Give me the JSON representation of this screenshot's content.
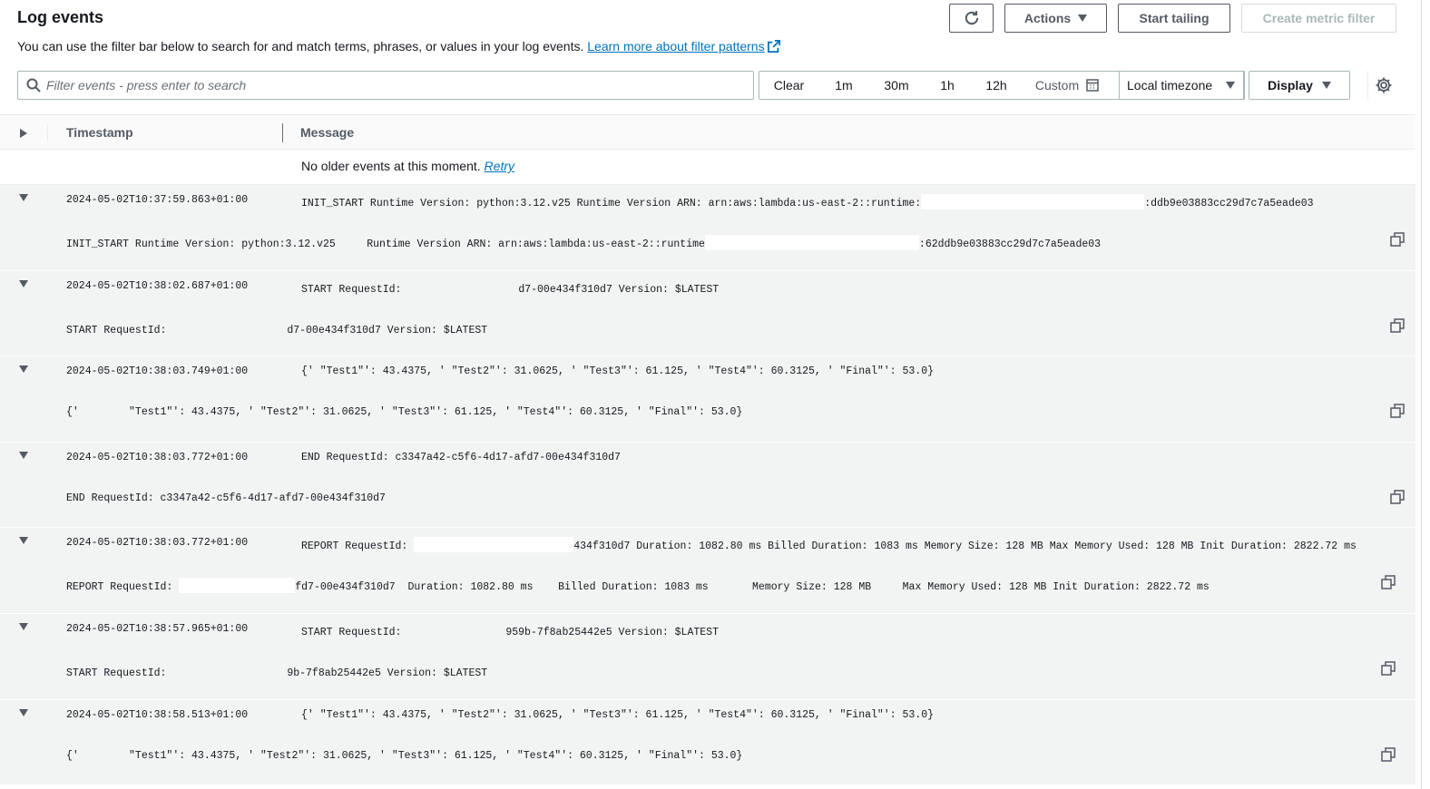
{
  "header": {
    "title": "Log events",
    "subtitle": "You can use the filter bar below to search for and match terms, phrases, or values in your log events.",
    "learn_more": "Learn more about filter patterns"
  },
  "toolbar": {
    "actions_label": "Actions",
    "start_tailing_label": "Start tailing",
    "create_metric_filter_label": "Create metric filter"
  },
  "filter": {
    "placeholder": "Filter events - press enter to search",
    "clear": "Clear",
    "ranges": [
      "1m",
      "30m",
      "1h",
      "12h"
    ],
    "custom": "Custom",
    "timezone": "Local timezone",
    "display": "Display"
  },
  "table": {
    "col_timestamp": "Timestamp",
    "col_message": "Message",
    "no_older": "No older events at this moment.",
    "retry": "Retry"
  },
  "events": [
    {
      "timestamp": "2024-05-02T10:37:59.863+01:00",
      "msg_a": "INIT_START Runtime Version: python:3.12.v25 Runtime Version ARN: arn:aws:lambda:us-east-2::runtime:",
      "msg_b": ":ddb9e03883cc29d7c7a5eade03",
      "det_a": "INIT_START Runtime Version: python:3.12.v25     Runtime Version ARN: arn:aws:lambda:us-east-2::runtime",
      "det_b": ":62ddb9e03883cc29d7c7a5eade03"
    },
    {
      "timestamp": "2024-05-02T10:38:02.687+01:00",
      "msg_a": "START RequestId: ",
      "msg_b": "d7-00e434f310d7 Version: $LATEST",
      "det_a": "START RequestId: ",
      "det_b": "d7-00e434f310d7 Version: $LATEST"
    },
    {
      "timestamp": "2024-05-02T10:38:03.749+01:00",
      "msg_a": "{' \"Test1\"': 43.4375, ' \"Test2\"': 31.0625, ' \"Test3\"': 61.125, ' \"Test4\"': 60.3125, ' \"Final\"': 53.0}",
      "msg_b": "",
      "det_a": "{'        \"Test1\"': 43.4375, ' \"Test2\"': 31.0625, ' \"Test3\"': 61.125, ' \"Test4\"': 60.3125, ' \"Final\"': 53.0}",
      "det_b": ""
    },
    {
      "timestamp": "2024-05-02T10:38:03.772+01:00",
      "msg_a": "END RequestId: c3347a42-c5f6-4d17-afd7-00e434f310d7",
      "msg_b": "",
      "det_a": "END RequestId: c3347a42-c5f6-4d17-afd7-00e434f310d7",
      "det_b": ""
    },
    {
      "timestamp": "2024-05-02T10:38:03.772+01:00",
      "msg_a": "REPORT RequestId: ",
      "msg_b": "434f310d7 Duration: 1082.80 ms Billed Duration: 1083 ms Memory Size: 128 MB Max Memory Used: 128 MB Init Duration: 2822.72 ms",
      "det_a": "REPORT RequestId: ",
      "det_b": "fd7-00e434f310d7  Duration: 1082.80 ms    Billed Duration: 1083 ms       Memory Size: 128 MB     Max Memory Used: 128 MB Init Duration: 2822.72 ms"
    },
    {
      "timestamp": "2024-05-02T10:38:57.965+01:00",
      "msg_a": "START RequestId: ",
      "msg_b": "959b-7f8ab25442e5 Version: $LATEST",
      "det_a": "START RequestId: ",
      "det_b": "9b-7f8ab25442e5 Version: $LATEST"
    },
    {
      "timestamp": "2024-05-02T10:38:58.513+01:00",
      "msg_a": "{' \"Test1\"': 43.4375, ' \"Test2\"': 31.0625, ' \"Test3\"': 61.125, ' \"Test4\"': 60.3125, ' \"Final\"': 53.0}",
      "msg_b": "",
      "det_a": "{'        \"Test1\"': 43.4375, ' \"Test2\"': 31.0625, ' \"Test3\"': 61.125, ' \"Test4\"': 60.3125, ' \"Final\"': 53.0}",
      "det_b": ""
    }
  ],
  "colors": {
    "link": "#0073bb",
    "row_bg": "#f2f3f3",
    "text": "#16191f",
    "muted": "#545b64"
  }
}
